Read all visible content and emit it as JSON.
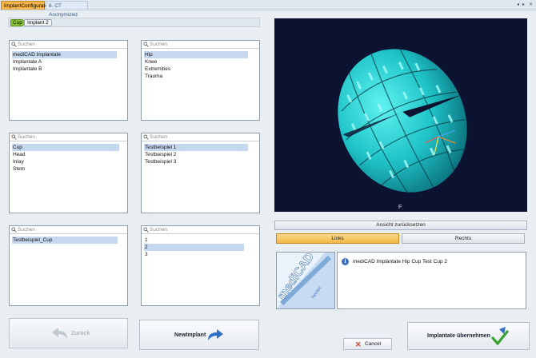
{
  "tabs": [
    {
      "label": "ImplantConfigurator"
    },
    {
      "label": "8. CT Anonymized"
    }
  ],
  "window_controls": {
    "prev": "◂",
    "next": "▸",
    "close": "✕"
  },
  "breadcrumb": {
    "step1": "Cup",
    "step2": "Implant 2"
  },
  "search_placeholder": "Suchen",
  "panels": {
    "manufacturer": {
      "items": [
        "mediCAD Implantate",
        "Implantate A",
        "Implantate B"
      ],
      "selected_index": 0
    },
    "region": {
      "items": [
        "Hip",
        "Knee",
        "Extremities",
        "Trauma"
      ],
      "selected_index": 0
    },
    "component": {
      "items": [
        "Cup",
        "Head",
        "Inlay",
        "Stem"
      ],
      "selected_index": 0
    },
    "example": {
      "items": [
        "Testbeispiel 1",
        "Testbeispiel 2",
        "Testbeispiel 3"
      ],
      "selected_index": 0
    },
    "type": {
      "items": [
        "Testbeispiel_Cup"
      ],
      "selected_index": 0
    },
    "size": {
      "items": [
        "1",
        "2",
        "3"
      ],
      "selected_index": 1
    }
  },
  "viewer": {
    "orientation_label": "F",
    "accent": "#1fd3d3",
    "background": "#0b1330"
  },
  "view_controls": {
    "reset_label": "Ansicht zurücksetzen",
    "left_label": "Links",
    "right_label": "Rechts",
    "active": "Links"
  },
  "info": {
    "icon": "info-icon",
    "text": "mediCAD Implantate Hip Cup Test Cup 2",
    "logo_text": "mediCAD",
    "logo_subtext": "hectec"
  },
  "buttons": {
    "back_label": "Zurück",
    "new_implant_label": "NewImplant",
    "cancel_label": "Cancel",
    "apply_label": "Implantate übernehmen"
  }
}
